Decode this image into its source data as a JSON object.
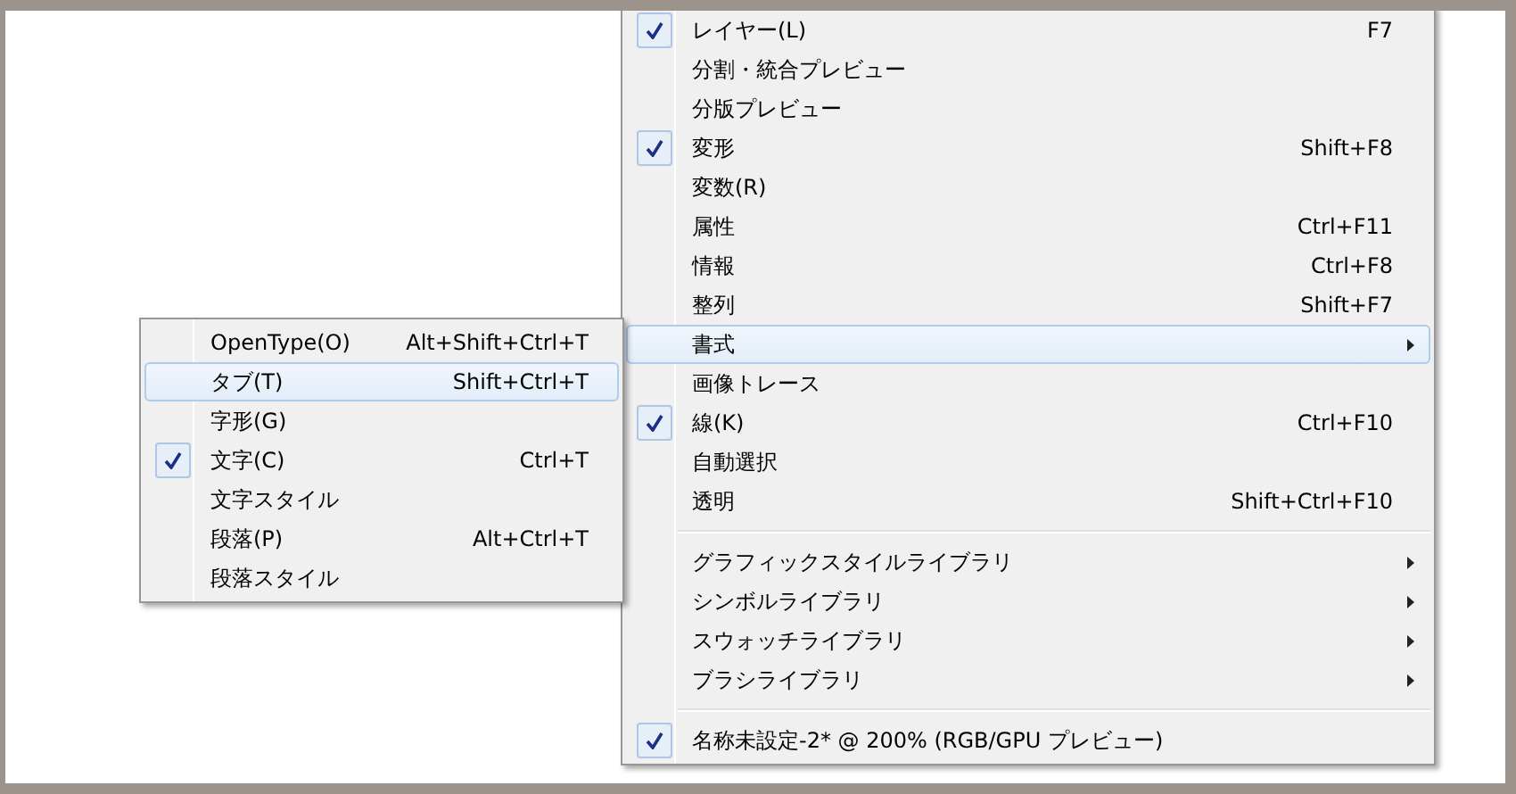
{
  "main_menu": {
    "items": [
      {
        "kind": "item",
        "label": "レイヤー(L)",
        "shortcut": "F7",
        "checked": true,
        "submenu": false,
        "selected": false
      },
      {
        "kind": "item",
        "label": "分割・統合プレビュー",
        "checked": false,
        "submenu": false,
        "selected": false
      },
      {
        "kind": "item",
        "label": "分版プレビュー",
        "checked": false,
        "submenu": false,
        "selected": false
      },
      {
        "kind": "item",
        "label": "変形",
        "shortcut": "Shift+F8",
        "checked": true,
        "submenu": false,
        "selected": false
      },
      {
        "kind": "item",
        "label": "変数(R)",
        "checked": false,
        "submenu": false,
        "selected": false
      },
      {
        "kind": "item",
        "label": "属性",
        "shortcut": "Ctrl+F11",
        "checked": false,
        "submenu": false,
        "selected": false
      },
      {
        "kind": "item",
        "label": "情報",
        "shortcut": "Ctrl+F8",
        "checked": false,
        "submenu": false,
        "selected": false
      },
      {
        "kind": "item",
        "label": "整列",
        "shortcut": "Shift+F7",
        "checked": false,
        "submenu": false,
        "selected": false
      },
      {
        "kind": "item",
        "label": "書式",
        "checked": false,
        "submenu": true,
        "selected": true
      },
      {
        "kind": "item",
        "label": "画像トレース",
        "checked": false,
        "submenu": false,
        "selected": false
      },
      {
        "kind": "item",
        "label": "線(K)",
        "shortcut": "Ctrl+F10",
        "checked": true,
        "submenu": false,
        "selected": false
      },
      {
        "kind": "item",
        "label": "自動選択",
        "checked": false,
        "submenu": false,
        "selected": false
      },
      {
        "kind": "item",
        "label": "透明",
        "shortcut": "Shift+Ctrl+F10",
        "checked": false,
        "submenu": false,
        "selected": false
      },
      {
        "kind": "separator"
      },
      {
        "kind": "item",
        "label": "グラフィックスタイルライブラリ",
        "checked": false,
        "submenu": true,
        "selected": false
      },
      {
        "kind": "item",
        "label": "シンボルライブラリ",
        "checked": false,
        "submenu": true,
        "selected": false
      },
      {
        "kind": "item",
        "label": "スウォッチライブラリ",
        "checked": false,
        "submenu": true,
        "selected": false
      },
      {
        "kind": "item",
        "label": "ブラシライブラリ",
        "checked": false,
        "submenu": true,
        "selected": false
      },
      {
        "kind": "separator"
      },
      {
        "kind": "item",
        "label": "名称未設定-2* @ 200% (RGB/GPU プレビュー)",
        "checked": true,
        "submenu": false,
        "selected": false
      }
    ]
  },
  "submenu": {
    "items": [
      {
        "kind": "item",
        "label": "OpenType(O)",
        "shortcut": "Alt+Shift+Ctrl+T",
        "checked": false,
        "submenu": false,
        "selected": false
      },
      {
        "kind": "item",
        "label": "タブ(T)",
        "shortcut": "Shift+Ctrl+T",
        "checked": false,
        "submenu": false,
        "selected": true
      },
      {
        "kind": "item",
        "label": "字形(G)",
        "checked": false,
        "submenu": false,
        "selected": false
      },
      {
        "kind": "item",
        "label": "文字(C)",
        "shortcut": "Ctrl+T",
        "checked": true,
        "submenu": false,
        "selected": false
      },
      {
        "kind": "item",
        "label": "文字スタイル",
        "checked": false,
        "submenu": false,
        "selected": false
      },
      {
        "kind": "item",
        "label": "段落(P)",
        "shortcut": "Alt+Ctrl+T",
        "checked": false,
        "submenu": false,
        "selected": false
      },
      {
        "kind": "item",
        "label": "段落スタイル",
        "checked": false,
        "submenu": false,
        "selected": false
      }
    ]
  }
}
